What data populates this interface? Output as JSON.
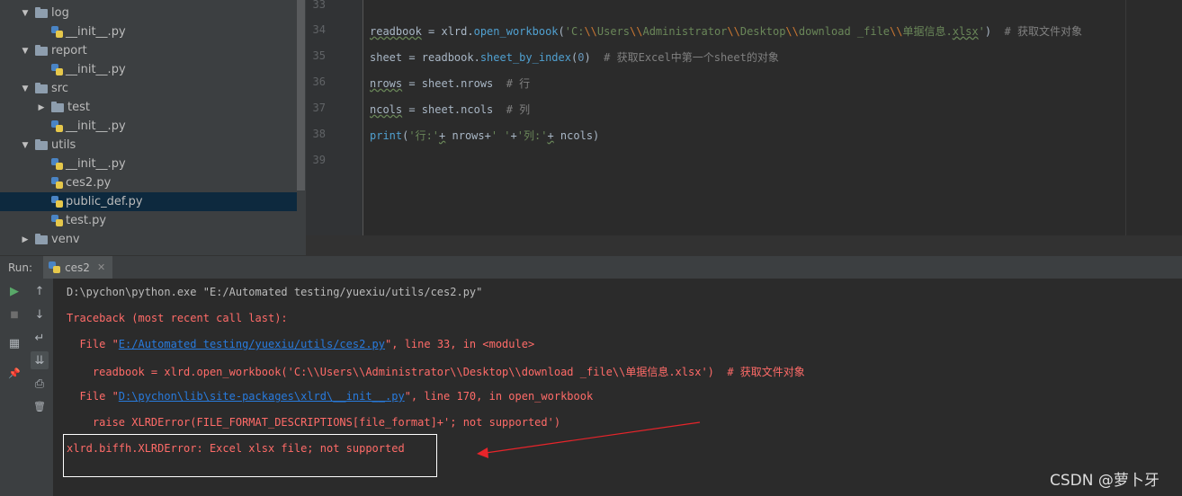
{
  "project_tree": {
    "rows": [
      {
        "label": "log",
        "kind": "folder",
        "depth": 0,
        "expanded": true
      },
      {
        "label": "__init__.py",
        "kind": "python",
        "depth": 1
      },
      {
        "label": "report",
        "kind": "folder",
        "depth": 0,
        "expanded": true
      },
      {
        "label": "__init__.py",
        "kind": "python",
        "depth": 1
      },
      {
        "label": "src",
        "kind": "folder",
        "depth": 0,
        "expanded": true
      },
      {
        "label": "test",
        "kind": "folder",
        "depth": 1,
        "expanded": false
      },
      {
        "label": "__init__.py",
        "kind": "python",
        "depth": 1
      },
      {
        "label": "utils",
        "kind": "folder",
        "depth": 0,
        "expanded": true
      },
      {
        "label": "__init__.py",
        "kind": "python",
        "depth": 1
      },
      {
        "label": "ces2.py",
        "kind": "python",
        "depth": 1
      },
      {
        "label": "public_def.py",
        "kind": "python",
        "depth": 1,
        "selected": true
      },
      {
        "label": "test.py",
        "kind": "python",
        "depth": 1
      },
      {
        "label": "venv",
        "kind": "folder",
        "depth": 0,
        "expanded": false
      }
    ]
  },
  "editor": {
    "line_numbers": [
      "33",
      "34",
      "35",
      "36",
      "37",
      "38",
      "39"
    ],
    "code": {
      "l34": {
        "var": "readbook",
        "eq": " = xlrd.",
        "fn": "open_workbook",
        "open": "(",
        "str_a": "'C:",
        "esc1": "\\\\",
        "str_b": "Users",
        "esc2": "\\\\",
        "str_c": "Administrator",
        "esc3": "\\\\",
        "str_d": "Desktop",
        "esc4": "\\\\",
        "str_e": "download _file",
        "esc5": "\\\\",
        "str_f": "单据信息.",
        "str_g": "xlsx",
        "str_h": "'",
        "close": ")  ",
        "comment": "# 获取文件对象"
      },
      "l35": {
        "pre": "sheet = readbook.",
        "fn": "sheet_by_index",
        "open": "(",
        "num": "0",
        "close": ")  ",
        "comment": "# 获取Excel中第一个sheet的对象"
      },
      "l36": {
        "var": "nrows",
        "rest": " = sheet.nrows  ",
        "comment": "# 行"
      },
      "l37": {
        "var": "ncols",
        "rest": " = sheet.ncols  ",
        "comment": "# 列"
      },
      "l38": {
        "fn": "print",
        "open": "(",
        "s1": "'行:'",
        "op1": "+",
        "mid": " nrows+",
        "s2": "' '",
        "plus": "+",
        "s3": "'列:'",
        "op2": "+",
        "end": " ncols)"
      }
    }
  },
  "run": {
    "label": "Run:",
    "tab": "ces2",
    "tab_close": "✕",
    "toolbar": {
      "run": "▶",
      "stop": "■",
      "up": "↑",
      "down": "↓",
      "wrap": "↵",
      "scroll_end": "⇊",
      "layout": "▦",
      "pin": "📌",
      "print": "⎙",
      "trash": "🗑"
    },
    "console": {
      "cmd": "D:\\pychon\\python.exe \"E:/Automated testing/yuexiu/utils/ces2.py\"",
      "traceback": "Traceback (most recent call last):",
      "file1_pre": "  File \"",
      "file1_link": "E:/Automated testing/yuexiu/utils/ces2.py",
      "file1_post": "\", line 33, in <module>",
      "code1": "    readbook = xlrd.open_workbook('C:\\\\Users\\\\Administrator\\\\Desktop\\\\download _file\\\\单据信息.xlsx')  # 获取文件对象",
      "file2_pre": "  File \"",
      "file2_link": "D:\\pychon\\lib\\site-packages\\xlrd\\__init__.py",
      "file2_post": "\", line 170, in open_workbook",
      "code2": "    raise XLRDError(FILE_FORMAT_DESCRIPTIONS[file_format]+'; not supported')",
      "error": "xlrd.biffh.XLRDError: Excel xlsx file; not supported"
    }
  },
  "watermark": "CSDN @萝卜牙",
  "colors": {
    "annotation_arrow": "#e8242a",
    "error_text": "#ff6b68",
    "link": "#287bde",
    "selection": "#0d293e"
  }
}
